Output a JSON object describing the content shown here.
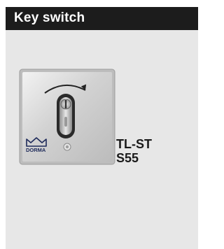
{
  "header": {
    "title": "Key switch"
  },
  "product": {
    "brand_logo_text": "DORMA",
    "model_line1": "TL-ST",
    "model_line2": "S55"
  },
  "colors": {
    "header_bg": "#1c1c1c",
    "header_text": "#ffffff",
    "panel_bg": "#e7e7e7",
    "label_text": "#1a1a1a"
  },
  "icons": {
    "rotation_arrow": "curved-arrow-clockwise-icon",
    "lock_cylinder": "key-cylinder-icon",
    "brand_logo": "dorma-logo",
    "mounting_screw": "screw-icon"
  }
}
